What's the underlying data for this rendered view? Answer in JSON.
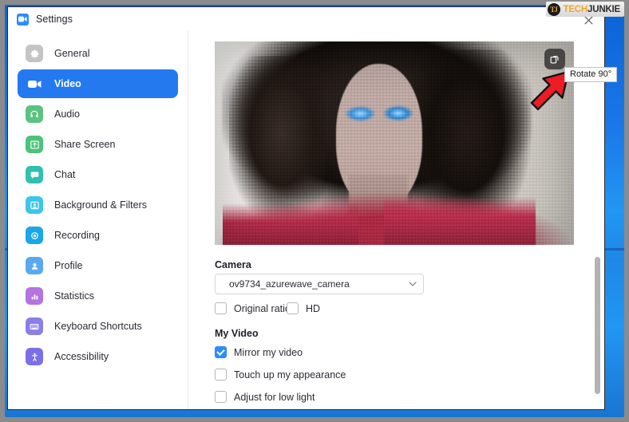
{
  "window": {
    "title": "Settings",
    "logo_icon": "zoom-camera-icon",
    "close_icon": "close-x-icon"
  },
  "watermark": {
    "badge": "TJ",
    "part1": "TECH",
    "part2": "JUNKIE"
  },
  "sidebar": {
    "items": [
      {
        "label": "General",
        "icon": "gear-icon",
        "color": "#bfbfbf",
        "selected": false
      },
      {
        "label": "Video",
        "icon": "video-camera-icon",
        "color": "#2479ef",
        "selected": true
      },
      {
        "label": "Audio",
        "icon": "headphones-icon",
        "color": "#5ac37f",
        "selected": false
      },
      {
        "label": "Share Screen",
        "icon": "share-screen-icon",
        "color": "#4cc27b",
        "selected": false
      },
      {
        "label": "Chat",
        "icon": "chat-bubble-icon",
        "color": "#2fc0b0",
        "selected": false
      },
      {
        "label": "Background & Filters",
        "icon": "person-frame-icon",
        "color": "#3cc6e8",
        "selected": false
      },
      {
        "label": "Recording",
        "icon": "record-circle-icon",
        "color": "#1aa7e8",
        "selected": false
      },
      {
        "label": "Profile",
        "icon": "person-icon",
        "color": "#5aa9f0",
        "selected": false
      },
      {
        "label": "Statistics",
        "icon": "bar-chart-icon",
        "color": "#b473e0",
        "selected": false
      },
      {
        "label": "Keyboard Shortcuts",
        "icon": "keyboard-icon",
        "color": "#8a7ee8",
        "selected": false
      },
      {
        "label": "Accessibility",
        "icon": "accessibility-icon",
        "color": "#7b6fe6",
        "selected": false
      }
    ]
  },
  "preview": {
    "rotate_button_icon": "rotate-90-icon",
    "rotate_tooltip": "Rotate 90°",
    "annotation_icon": "red-arrow-icon"
  },
  "form": {
    "camera_label": "Camera",
    "camera_value": "ov9734_azurewave_camera",
    "camera_chevron": "chevron-down-icon",
    "original_ratio_label": "Original ratio",
    "original_ratio_checked": false,
    "hd_label": "HD",
    "hd_checked": false,
    "my_video_label": "My Video",
    "mirror_label": "Mirror my video",
    "mirror_checked": true,
    "touchup_label": "Touch up my appearance",
    "touchup_checked": false,
    "lowlight_label": "Adjust for low light",
    "lowlight_checked": false
  },
  "colors": {
    "accent": "#2d8cff",
    "selected_nav": "#2479ef",
    "desktop": "#2196f3",
    "arrow": "#ee1c25"
  }
}
